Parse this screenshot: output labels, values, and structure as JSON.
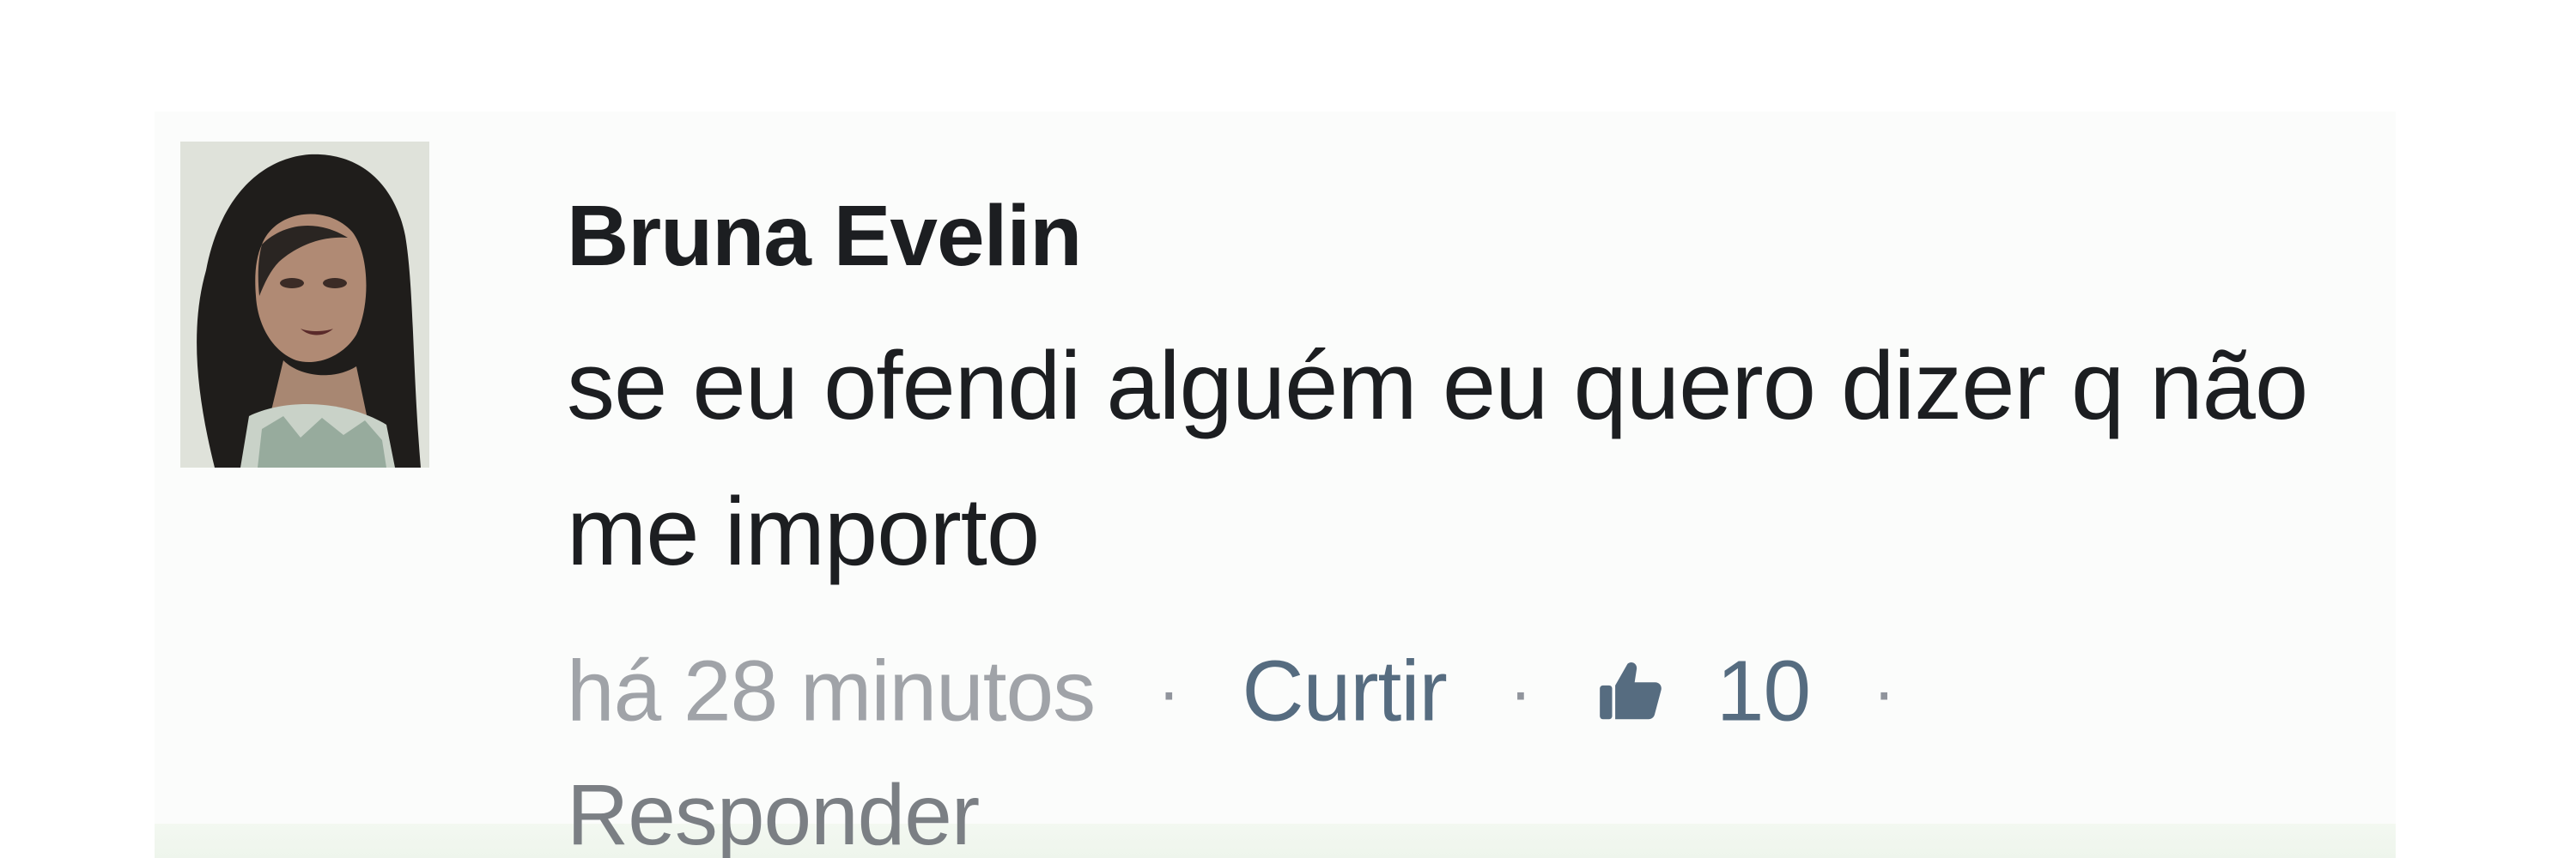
{
  "comment": {
    "author": "Bruna Evelin",
    "text": "se eu ofendi alguém eu quero dizer q não me importo",
    "timestamp": "há 28 minutos",
    "separator": "·",
    "like_label": "Curtir",
    "like_count": "10",
    "reply_label": "Responder"
  },
  "icons": {
    "like": "thumbs-up-icon",
    "avatar": "profile-photo"
  },
  "colors": {
    "author": "#1c1e21",
    "text": "#1c1e21",
    "timestamp": "#a0a3a8",
    "action": "#566c80"
  }
}
